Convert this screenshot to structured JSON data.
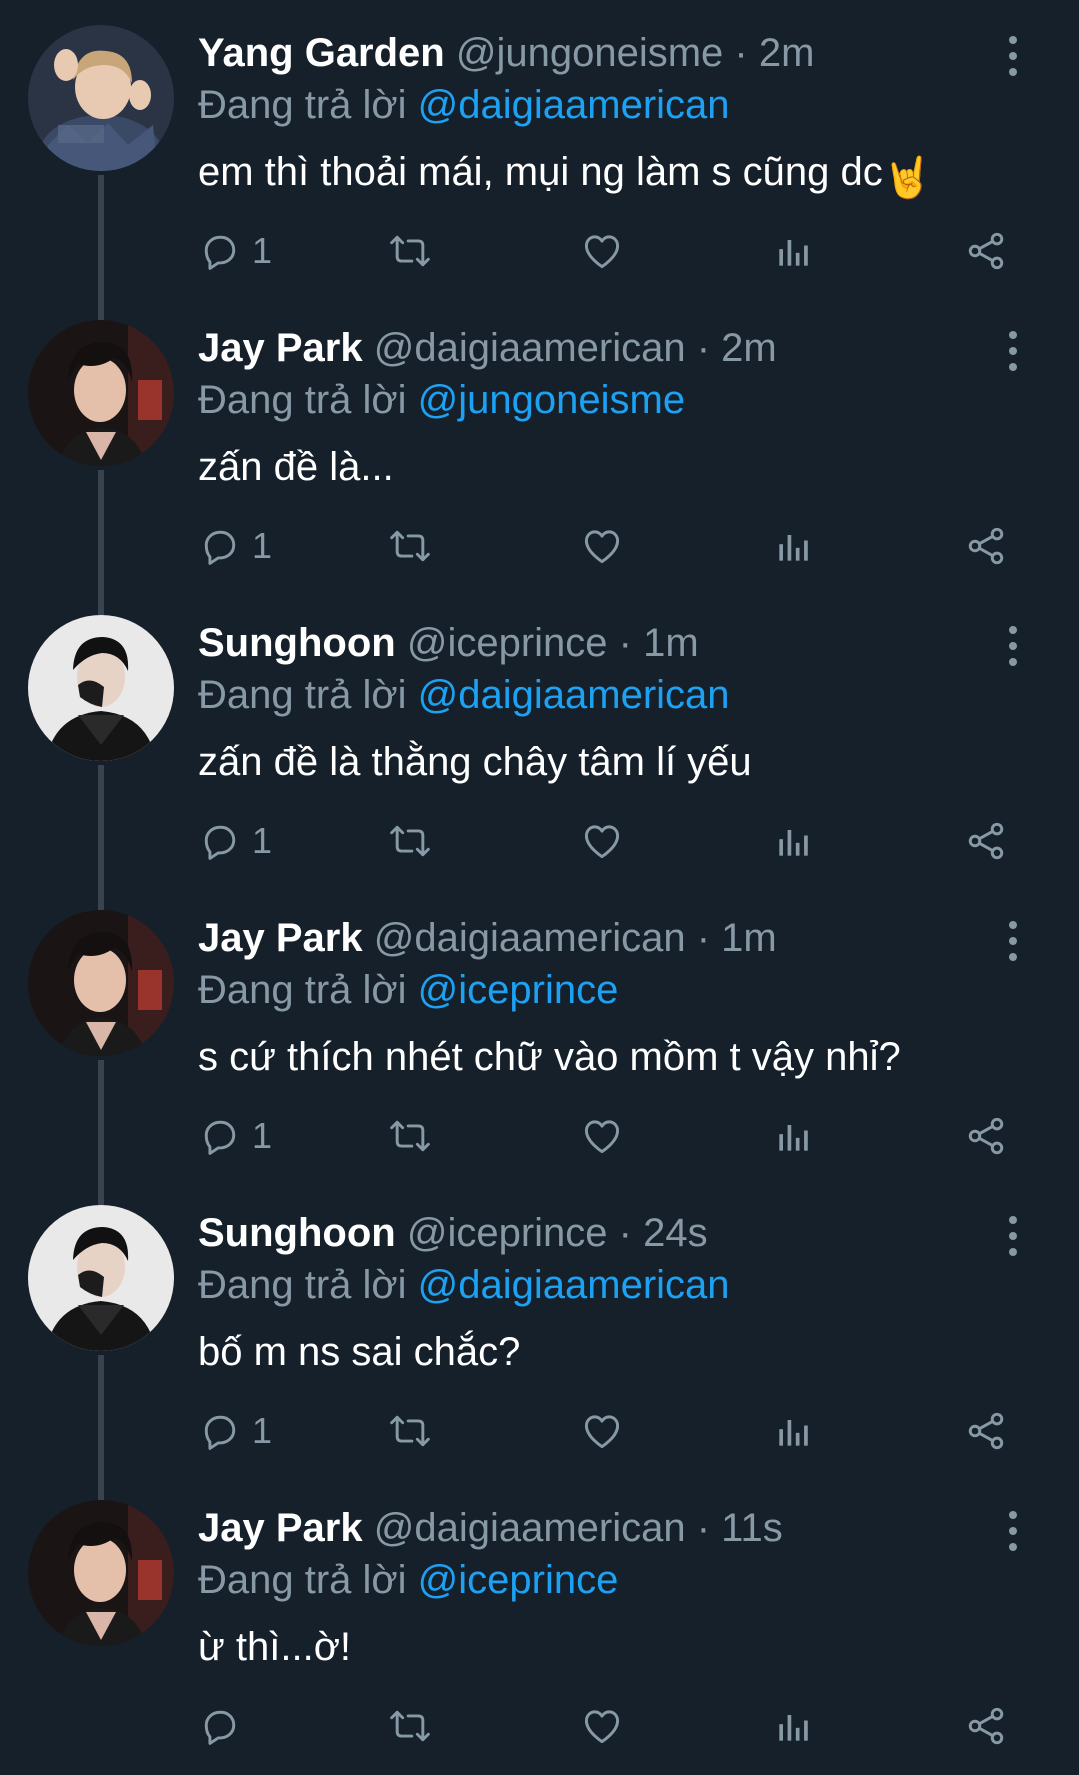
{
  "colors": {
    "background": "#15202b",
    "secondary_text": "#8899a6",
    "mention": "#1da1f2",
    "thread_line": "#38444d"
  },
  "icons": {
    "reply": "reply-icon",
    "retweet": "retweet-icon",
    "like": "heart-icon",
    "stats": "stats-icon",
    "share": "share-icon",
    "more": "more-icon"
  },
  "tweets": [
    {
      "display_name": "Yang Garden",
      "handle": "@jungoneisme",
      "separator": "·",
      "time": "2m",
      "reply_prefix": "Đang trả lời",
      "reply_to": "@daigiaamerican",
      "text": "em thì thoải mái, mụi ng làm s cũng dc",
      "emoji": "🤘",
      "reply_count": "1"
    },
    {
      "display_name": "Jay Park",
      "handle": "@daigiaamerican",
      "separator": "·",
      "time": "2m",
      "reply_prefix": "Đang trả lời",
      "reply_to": "@jungoneisme",
      "text": "zấn đề là...",
      "reply_count": "1"
    },
    {
      "display_name": "Sunghoon",
      "handle": "@iceprince",
      "separator": "·",
      "time": "1m",
      "reply_prefix": "Đang trả lời",
      "reply_to": "@daigiaamerican",
      "text": "zấn đề là thằng chây tâm lí yếu",
      "reply_count": "1"
    },
    {
      "display_name": "Jay Park",
      "handle": "@daigiaamerican",
      "separator": "·",
      "time": "1m",
      "reply_prefix": "Đang trả lời",
      "reply_to": "@iceprince",
      "text": "s cứ thích nhét chữ vào mồm t vậy nhỉ?",
      "reply_count": "1"
    },
    {
      "display_name": "Sunghoon",
      "handle": "@iceprince",
      "separator": "·",
      "time": "24s",
      "reply_prefix": "Đang trả lời",
      "reply_to": "@daigiaamerican",
      "text": "bố m ns sai chắc?",
      "reply_count": "1"
    },
    {
      "display_name": "Jay Park",
      "handle": "@daigiaamerican",
      "separator": "·",
      "time": "11s",
      "reply_prefix": "Đang trả lời",
      "reply_to": "@iceprince",
      "text": "ừ thì...ờ!",
      "reply_count": ""
    }
  ]
}
